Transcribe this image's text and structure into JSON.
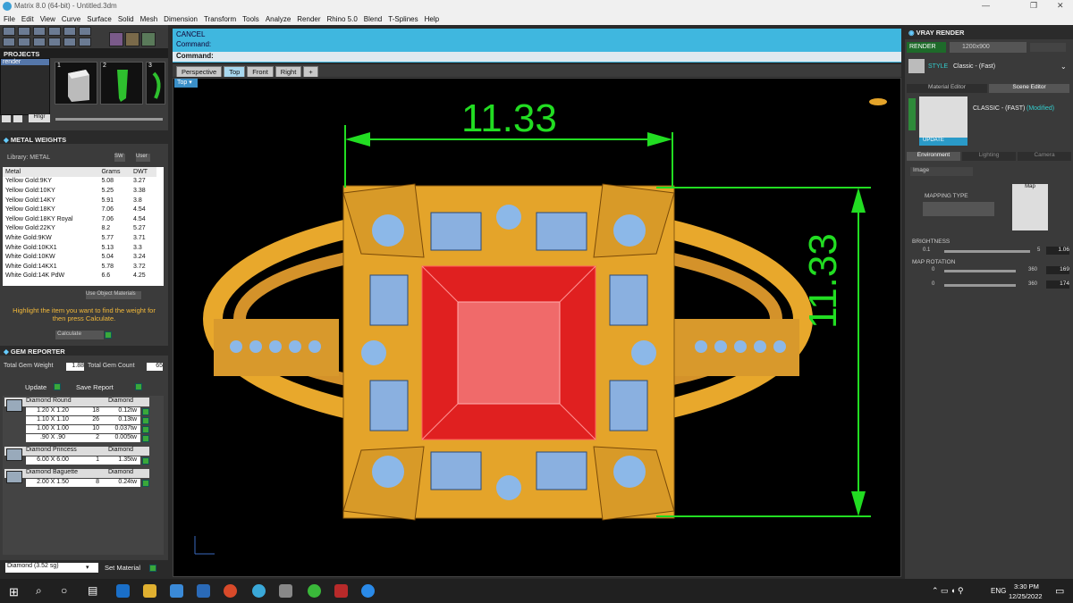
{
  "window": {
    "title": "Matrix 8.0 (64-bit) - Untitled.3dm",
    "min": "—",
    "max": "❐",
    "close": "✕"
  },
  "menu": [
    "File",
    "Edit",
    "View",
    "Curve",
    "Surface",
    "Solid",
    "Mesh",
    "Dimension",
    "Transform",
    "Tools",
    "Analyze",
    "Render",
    "Rhino 5.0",
    "Blend",
    "T-Splines",
    "Help"
  ],
  "projects": {
    "header": "PROJECTS",
    "selected": "render",
    "thumb_numbers": [
      "1",
      "2",
      "3"
    ],
    "hinge_label": "Hngr"
  },
  "metal_weights": {
    "header": "METAL WEIGHTS",
    "library_label": "Library: METAL",
    "sw_label": "SW",
    "user_label": "User",
    "columns": [
      "Metal",
      "Grams",
      "DWT"
    ],
    "rows": [
      [
        "Yellow Gold:9KY",
        "5.08",
        "3.27"
      ],
      [
        "Yellow Gold:10KY",
        "5.25",
        "3.38"
      ],
      [
        "Yellow Gold:14KY",
        "5.91",
        "3.8"
      ],
      [
        "Yellow Gold:18KY",
        "7.06",
        "4.54"
      ],
      [
        "Yellow Gold:18KY Royal",
        "7.06",
        "4.54"
      ],
      [
        "Yellow Gold:22KY",
        "8.2",
        "5.27"
      ],
      [
        "White Gold:9KW",
        "5.77",
        "3.71"
      ],
      [
        "White Gold:10KX1",
        "5.13",
        "3.3"
      ],
      [
        "White Gold:10KW",
        "5.04",
        "3.24"
      ],
      [
        "White Gold:14KX1",
        "5.78",
        "3.72"
      ],
      [
        "White Gold:14K PdW",
        "6.6",
        "4.25"
      ]
    ],
    "use_object_materials": "Use Object Materials",
    "hint": "Highlight the item you want to find the weight for then press Calculate.",
    "calculate": "Calculate"
  },
  "gem_reporter": {
    "header": "GEM REPORTER",
    "total_weight_label": "Total Gem Weight",
    "total_weight": "1.88",
    "total_count_label": "Total Gem Count",
    "total_count": "65",
    "update": "Update",
    "save_report": "Save Report",
    "groups": [
      {
        "name": "Diamond Round",
        "material": "Diamond",
        "rows": [
          [
            "1.20 X 1.20",
            "18",
            "0.12tw"
          ],
          [
            "1.10 X 1.10",
            "26",
            "0.13tw"
          ],
          [
            "1.00 X 1.00",
            "10",
            "0.037tw"
          ],
          [
            ".90 X .90",
            "2",
            "0.005tw"
          ]
        ]
      },
      {
        "name": "Diamond Princess",
        "material": "Diamond",
        "rows": [
          [
            "6.00 X 6.00",
            "1",
            "1.35tw"
          ]
        ]
      },
      {
        "name": "Diamond Baguette",
        "material": "Diamond",
        "rows": [
          [
            "2.00 X 1.50",
            "8",
            "0.24tw"
          ]
        ]
      }
    ],
    "material_select": "Diamond   (3.52 sg)",
    "set_material": "Set Material"
  },
  "command": {
    "line1": "CANCEL",
    "line2": "Command:",
    "prompt": "Command:"
  },
  "viewport_tabs": [
    "Perspective",
    "Top",
    "Front",
    "Right",
    "+"
  ],
  "active_tab": "Top",
  "viewport_label": "Top",
  "dimensions": {
    "horizontal": "11.33",
    "vertical": "11.33"
  },
  "vray": {
    "header": "VRAY RENDER",
    "render_btn": "RENDER",
    "resolution": "1200x900",
    "style_label": "STYLE",
    "style_value": "Classic - (Fast)",
    "tabs": [
      "Material Editor",
      "Scene Editor"
    ],
    "scene_name": "CLASSIC - (FAST)",
    "modified": "(Modified)",
    "update": "UPDATE",
    "env_tabs": [
      "Environment",
      "Lighting",
      "Camera"
    ],
    "image_select": "Image",
    "mapping_type": "MAPPING TYPE",
    "map_label": "Map",
    "brightness": "BRIGHTNESS",
    "brightness_min": "0.1",
    "brightness_max": "5",
    "brightness_val": "1.06",
    "map_rotation": "MAP ROTATION",
    "rot_min": "0",
    "rot_max": "360",
    "rot1": "169",
    "rot2": "174"
  },
  "taskbar": {
    "lang": "ENG",
    "time": "3:30 PM",
    "date": "12/25/2022"
  }
}
